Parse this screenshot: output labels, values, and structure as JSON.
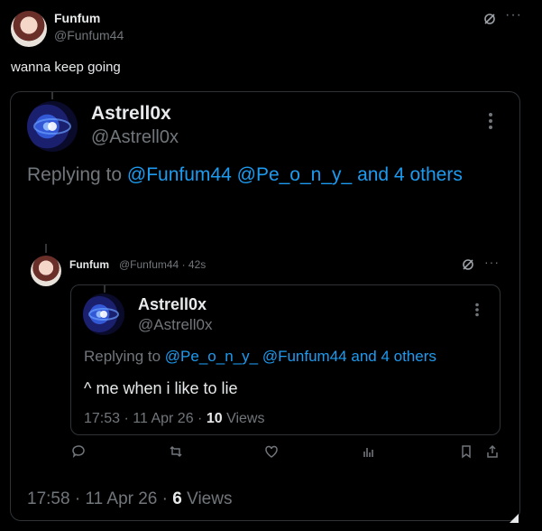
{
  "outer_tweet": {
    "author_name": "Funfum",
    "author_handle": "@Funfum44",
    "text": "wanna keep going"
  },
  "quoted_tweet": {
    "author_name": "Astrell0x",
    "author_handle": "@Astrell0x",
    "replying_prefix": "Replying to",
    "mention_1": "@Funfum44",
    "mention_2": "@Pe_o_n_y_",
    "others": "and 4 others",
    "time": "17:58",
    "date": "11 Apr 26",
    "views_count": "6",
    "views_label": "Views"
  },
  "reply_tweet": {
    "author_name": "Funfum",
    "author_handle": "@Funfum44",
    "time_ago": "42s"
  },
  "nested_quote": {
    "author_name": "Astrell0x",
    "author_handle": "@Astrell0x",
    "replying_prefix": "Replying to",
    "mention_1": "@Pe_o_n_y_",
    "mention_2": "@Funfum44",
    "others": "and 4 others",
    "text": "^ me when i like to lie",
    "time": "17:53",
    "date": "11 Apr 26",
    "views_count": "10",
    "views_label": "Views"
  },
  "ui": {
    "more_glyph": "···",
    "sep": "·",
    "icon_names": [
      "grok-icon",
      "more-icon",
      "reply-icon",
      "retweet-icon",
      "like-icon",
      "views-icon",
      "bookmark-icon",
      "share-icon"
    ]
  }
}
